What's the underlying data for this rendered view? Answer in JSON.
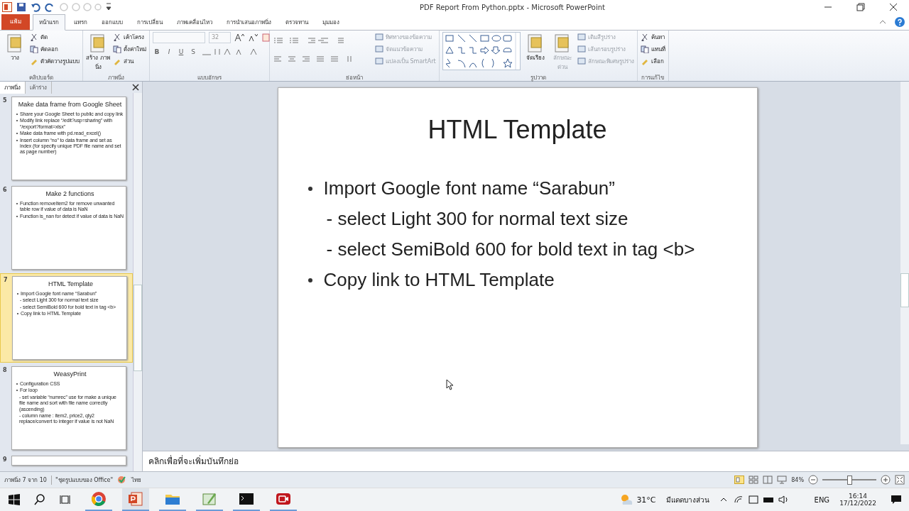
{
  "window": {
    "title": "PDF Report From Python.pptx - Microsoft PowerPoint"
  },
  "ribbon": {
    "file_tab": "แฟ้ม",
    "tabs": [
      {
        "label": "หน้าแรก",
        "selected": true
      },
      {
        "label": "แทรก",
        "selected": false
      },
      {
        "label": "ออกแบบ",
        "selected": false
      },
      {
        "label": "การเปลี่ยน",
        "selected": false
      },
      {
        "label": "ภาพเคลื่อนไหว",
        "selected": false
      },
      {
        "label": "การนำเสนอภาพนิ่ง",
        "selected": false
      },
      {
        "label": "ตรวจทาน",
        "selected": false
      },
      {
        "label": "มุมมอง",
        "selected": false
      }
    ],
    "groups": [
      {
        "kind": "buttons",
        "name": "คลิปบอร์ด",
        "big": [
          {
            "label": "วาง",
            "disabled": false
          }
        ],
        "items": [
          {
            "label": "ตัด",
            "disabled": false
          },
          {
            "label": "คัดลอก",
            "disabled": false
          },
          {
            "label": "ตัวคัดวางรูปแบบ",
            "disabled": false
          }
        ]
      },
      {
        "kind": "buttons",
        "name": "ภาพนิ่ง",
        "big": [
          {
            "label": "สร้าง ภาพนิ่ง",
            "disabled": false
          }
        ],
        "items": [
          {
            "label": "เค้าโครง",
            "disabled": false
          },
          {
            "label": "ตั้งค่าใหม่",
            "disabled": false
          },
          {
            "label": "ส่วน",
            "disabled": false
          }
        ]
      },
      {
        "kind": "font",
        "name": "แบบอักษร",
        "size": "32",
        "format": [
          "B",
          "I",
          "U",
          "S"
        ]
      },
      {
        "kind": "paragraph",
        "name": "ย่อหน้า",
        "items": [
          {
            "label": "ทิศทางของข้อความ",
            "disabled": true
          },
          {
            "label": "จัดแนวข้อความ",
            "disabled": true
          },
          {
            "label": "แปลงเป็น SmartArt",
            "disabled": true
          }
        ]
      },
      {
        "kind": "drawing",
        "name": "รูปวาด",
        "big": [
          {
            "label": "จัดเรียง",
            "disabled": false
          },
          {
            "label": "ลักษณะ ด่วน",
            "disabled": true
          }
        ],
        "items": [
          {
            "label": "เติมสีรูปร่าง",
            "disabled": true
          },
          {
            "label": "เส้นกรอบรูปร่าง",
            "disabled": true
          },
          {
            "label": "ลักษณะพิเศษรูปร่าง",
            "disabled": true
          }
        ]
      },
      {
        "kind": "buttons",
        "name": "การแก้ไข",
        "items": [
          {
            "label": "ค้นหา",
            "disabled": false
          },
          {
            "label": "แทนที่",
            "disabled": false
          },
          {
            "label": "เลือก",
            "disabled": false
          }
        ]
      }
    ]
  },
  "slides_panel": {
    "tabs": [
      {
        "label": "ภาพนิ่ง",
        "selected": true
      },
      {
        "label": "เค้าร่าง",
        "selected": false
      }
    ],
    "slides": [
      {
        "number": "5",
        "title": "Make data frame from Google Sheet",
        "selected": false,
        "bullets": [
          {
            "kind": "bullet",
            "text": "Share your Google Sheet to public and copy link"
          },
          {
            "kind": "bullet",
            "text": "Modify link replace “/edit?usp=sharing” with “/export?format=xlsx”"
          },
          {
            "kind": "bullet",
            "text": "Make data frame with pd.read_excel()"
          },
          {
            "kind": "bullet",
            "text": "Insert column “no” to data frame and set as index (for specify unique PDF file name and set as page number)"
          }
        ]
      },
      {
        "number": "6",
        "title": "Make 2 functions",
        "selected": false,
        "bullets": [
          {
            "kind": "bullet",
            "text": "Function removeItem2 for remove unwanted table row if value of data is NaN"
          },
          {
            "kind": "bullet",
            "text": "Function is_nan for detect if value of data is NaN"
          }
        ]
      },
      {
        "number": "7",
        "title": "HTML Template",
        "selected": true,
        "bullets": [
          {
            "kind": "bullet",
            "text": "Import Google font name “Sarabun”"
          },
          {
            "kind": "sub",
            "text": "- select Light 300 for normal text size"
          },
          {
            "kind": "sub",
            "text": "- select SemiBold 600 for bold text in tag <b>"
          },
          {
            "kind": "bullet",
            "text": "Copy link to HTML Template"
          }
        ]
      },
      {
        "number": "8",
        "title": "WeasyPrint",
        "selected": false,
        "bullets": [
          {
            "kind": "bullet",
            "text": "Configuration CSS"
          },
          {
            "kind": "bullet",
            "text": "For loop"
          },
          {
            "kind": "sub",
            "text": "- set variable “numrec” use for make a unique file name and sort with file name correctly (ascending)"
          },
          {
            "kind": "sub",
            "text": "- column name : item2, price2, qty2 replace/convert to integer if value is not NaN"
          }
        ]
      },
      {
        "number": "9",
        "selected": false
      }
    ]
  },
  "slide": {
    "title": "HTML Template",
    "bullets": [
      {
        "kind": "bullet",
        "text": "Import Google font name “Sarabun”"
      },
      {
        "kind": "sub",
        "text": "- select Light 300 for normal text size"
      },
      {
        "kind": "sub",
        "text": "- select SemiBold 600 for bold text in tag <b>"
      },
      {
        "kind": "bullet",
        "text": "Copy link to HTML Template"
      }
    ]
  },
  "notes": {
    "placeholder": "คลิกเพื่อที่จะเพิ่มบันทึกย่อ"
  },
  "status_bar": {
    "slide_count": "ภาพนิ่ง 7 จาก 10",
    "theme": "\"ชุดรูปแบบของ Office\"",
    "language": "ไทย",
    "zoom": "84%",
    "zoom_slider": {
      "level": 0.5
    }
  },
  "taskbar": {
    "apps": [
      {
        "kind": "browser",
        "selected": false
      },
      {
        "kind": "slides",
        "selected": true
      },
      {
        "kind": "folder",
        "selected": false
      },
      {
        "kind": "paint",
        "selected": false
      },
      {
        "kind": "terminal",
        "selected": false
      },
      {
        "kind": "recorder",
        "selected": false
      }
    ],
    "temperature": "31°C",
    "weather": "มีแดดบางส่วน",
    "input_language": "ENG",
    "time": "16:14",
    "date": "17/12/2022"
  }
}
